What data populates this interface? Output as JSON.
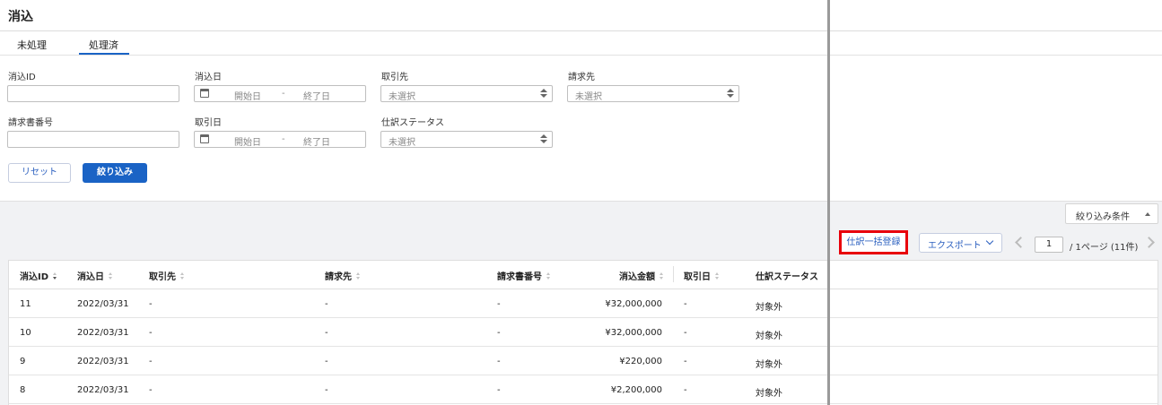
{
  "app": {
    "title": "消込"
  },
  "tabs": [
    {
      "label": "未処理",
      "active": false
    },
    {
      "label": "処理済",
      "active": true
    }
  ],
  "filters": {
    "reconciliation_id": {
      "label": "消込ID",
      "value": ""
    },
    "reconciliation_date": {
      "label": "消込日",
      "start_placeholder": "開始日",
      "separator": "-",
      "end_placeholder": "終了日"
    },
    "counterparty": {
      "label": "取引先",
      "placeholder": "未選択"
    },
    "billing_to": {
      "label": "請求先",
      "placeholder": "未選択"
    },
    "invoice_number": {
      "label": "請求書番号",
      "value": ""
    },
    "transaction_date": {
      "label": "取引日",
      "start_placeholder": "開始日",
      "separator": "-",
      "end_placeholder": "終了日"
    },
    "journal_status": {
      "label": "仕訳ステータス",
      "placeholder": "未選択"
    },
    "reset_label": "リセット",
    "apply_label": "絞り込み"
  },
  "toolbar": {
    "filter_conditions_label": "絞り込み条件",
    "bulk_journal_label": "仕訳一括登録",
    "export_label": "エクスポート"
  },
  "pagination": {
    "current_page": "1",
    "summary": "/ 1ページ (11件)"
  },
  "table": {
    "columns": [
      "消込ID",
      "消込日",
      "取引先",
      "請求先",
      "請求書番号",
      "消込金額",
      "取引日",
      "仕訳ステータス"
    ],
    "rows": [
      [
        "11",
        "2022/03/31",
        "-",
        "-",
        "-",
        "¥32,000,000",
        "-",
        "対象外"
      ],
      [
        "10",
        "2022/03/31",
        "-",
        "-",
        "-",
        "¥32,000,000",
        "-",
        "対象外"
      ],
      [
        "9",
        "2022/03/31",
        "-",
        "-",
        "-",
        "¥220,000",
        "-",
        "対象外"
      ],
      [
        "8",
        "2022/03/31",
        "-",
        "-",
        "-",
        "¥2,200,000",
        "-",
        "対象外"
      ]
    ]
  },
  "colors": {
    "primary": "#1a63c5",
    "highlight": "#e8000b",
    "link": "#2a5fbf"
  }
}
